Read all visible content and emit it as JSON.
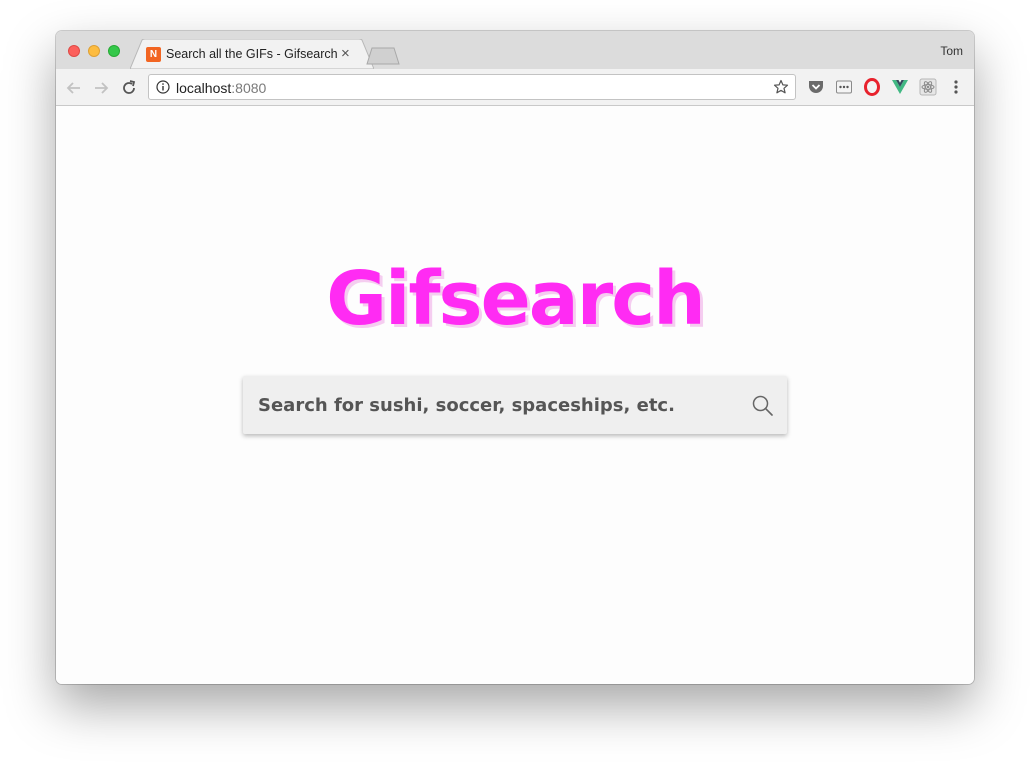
{
  "browser": {
    "tab": {
      "favicon_letter": "N",
      "title": "Search all the GIFs - Gifsearch",
      "close_glyph": "×"
    },
    "profile_name": "Tom",
    "address": {
      "host": "localhost",
      "port": ":8080"
    },
    "toolbar_icons": [
      "back-icon",
      "forward-icon",
      "reload-icon",
      "info-icon",
      "star-icon",
      "pocket-icon",
      "extension-dots-icon",
      "opera-icon",
      "vue-devtools-icon",
      "react-devtools-icon",
      "menu-icon"
    ]
  },
  "page": {
    "logo": "Gifsearch",
    "search_placeholder": "Search for sushi, soccer, spaceships, etc."
  },
  "colors": {
    "logo": "#ff2bf3",
    "logo_shadow": "#f5cdf0",
    "search_bg": "#efefef",
    "favicon": "#f26522"
  }
}
